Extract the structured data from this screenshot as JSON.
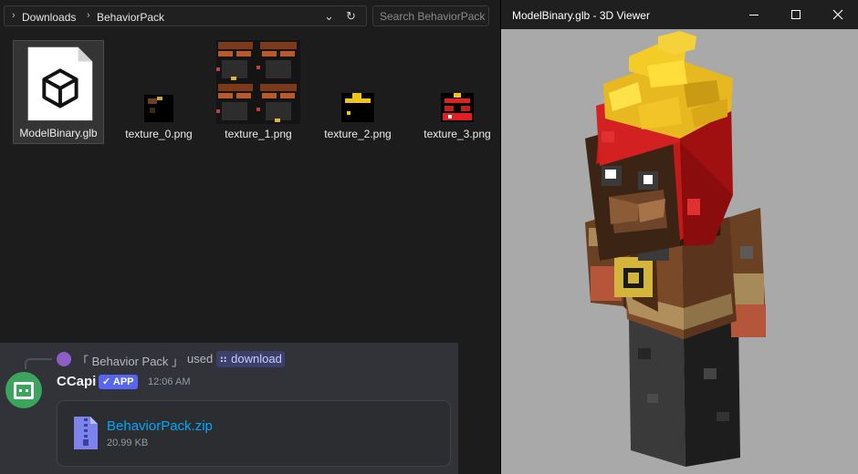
{
  "explorer": {
    "breadcrumb": [
      "Downloads",
      "BehaviorPack"
    ],
    "search_placeholder": "Search BehaviorPack",
    "files": [
      {
        "name": "ModelBinary.glb",
        "icon": "3d-model-file-icon"
      },
      {
        "name": "texture_0.png",
        "icon": "texture-thumbnail"
      },
      {
        "name": "texture_1.png",
        "icon": "texture-atlas-thumbnail"
      },
      {
        "name": "texture_2.png",
        "icon": "texture-thumbnail"
      },
      {
        "name": "texture_3.png",
        "icon": "texture-thumbnail"
      }
    ]
  },
  "discord": {
    "reply_command_source": "「 Behavior Pack 」",
    "reply_used": "used",
    "reply_command": "download",
    "author": "CCapi",
    "badge": "APP",
    "timestamp": "12:06 AM",
    "attachment": {
      "name": "BehaviorPack.zip",
      "size": "20.99 KB"
    }
  },
  "viewer": {
    "title": "ModelBinary.glb - 3D Viewer"
  },
  "colors": {
    "explorer_bg": "#1c1c1c",
    "discord_bg": "#313338",
    "link_blue": "#00a8fc",
    "app_badge": "#5865f2",
    "viewer_bg": "#a9a9a9"
  }
}
